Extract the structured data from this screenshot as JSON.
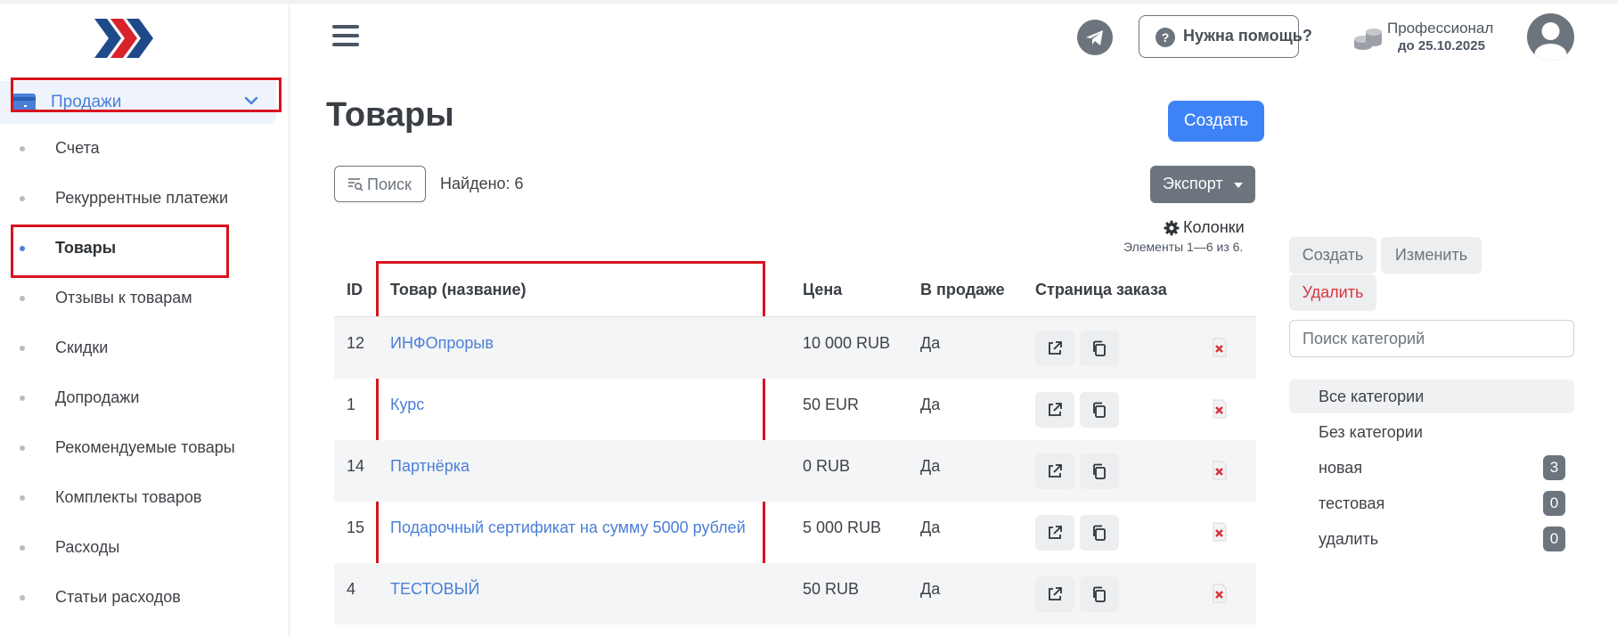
{
  "sidebar": {
    "logo": "brand-logo",
    "section": {
      "label": "Продажи",
      "icon": "card-icon",
      "expanded": true
    },
    "items": [
      {
        "label": "Счета",
        "active": false
      },
      {
        "label": "Рекуррентные платежи",
        "active": false
      },
      {
        "label": "Товары",
        "active": true
      },
      {
        "label": "Отзывы к товарам",
        "active": false
      },
      {
        "label": "Скидки",
        "active": false
      },
      {
        "label": "Допродажи",
        "active": false
      },
      {
        "label": "Рекомендуемые товары",
        "active": false
      },
      {
        "label": "Комплекты товаров",
        "active": false
      },
      {
        "label": "Расходы",
        "active": false
      },
      {
        "label": "Статьи расходов",
        "active": false
      }
    ]
  },
  "header": {
    "help_label": "Нужна помощь?",
    "plan_name": "Профессионал",
    "plan_until": "до 25.10.2025"
  },
  "main": {
    "title": "Товары",
    "create_label": "Создать",
    "search_label": "Поиск",
    "found_text": "Найдено: 6",
    "export_label": "Экспорт",
    "columns_label": "Колонки",
    "items_range": "Элементы 1—6 из 6."
  },
  "table": {
    "headers": {
      "id": "ID",
      "name": "Товар (название)",
      "price": "Цена",
      "on_sale": "В продаже",
      "order_page": "Страница заказа"
    },
    "rows": [
      {
        "id": "12",
        "name": "ИНФОпрорыв",
        "price": "10 000 RUB",
        "on_sale": "Да"
      },
      {
        "id": "1",
        "name": "Курс",
        "price": "50 EUR",
        "on_sale": "Да"
      },
      {
        "id": "14",
        "name": "Партнёрка",
        "price": "0 RUB",
        "on_sale": "Да"
      },
      {
        "id": "15",
        "name": "Подарочный сертификат на сумму 5000 рублей",
        "price": "5 000 RUB",
        "on_sale": "Да"
      },
      {
        "id": "4",
        "name": "ТЕСТОВЫЙ",
        "price": "50 RUB",
        "on_sale": "Да"
      }
    ]
  },
  "categories": {
    "create_label": "Создать",
    "edit_label": "Изменить",
    "delete_label": "Удалить",
    "search_placeholder": "Поиск категорий",
    "items": [
      {
        "name": "Все категории",
        "count": null,
        "active": true
      },
      {
        "name": "Без категории",
        "count": null,
        "active": false
      },
      {
        "name": "новая",
        "count": "3",
        "active": false
      },
      {
        "name": "тестовая",
        "count": "0",
        "active": false
      },
      {
        "name": "удалить",
        "count": "0",
        "active": false
      }
    ]
  },
  "colors": {
    "accent": "#3e82f7",
    "link": "#4a7fd8",
    "secondary": "#6c757d",
    "danger": "#d9363e",
    "highlight_box": "#d8131f"
  }
}
